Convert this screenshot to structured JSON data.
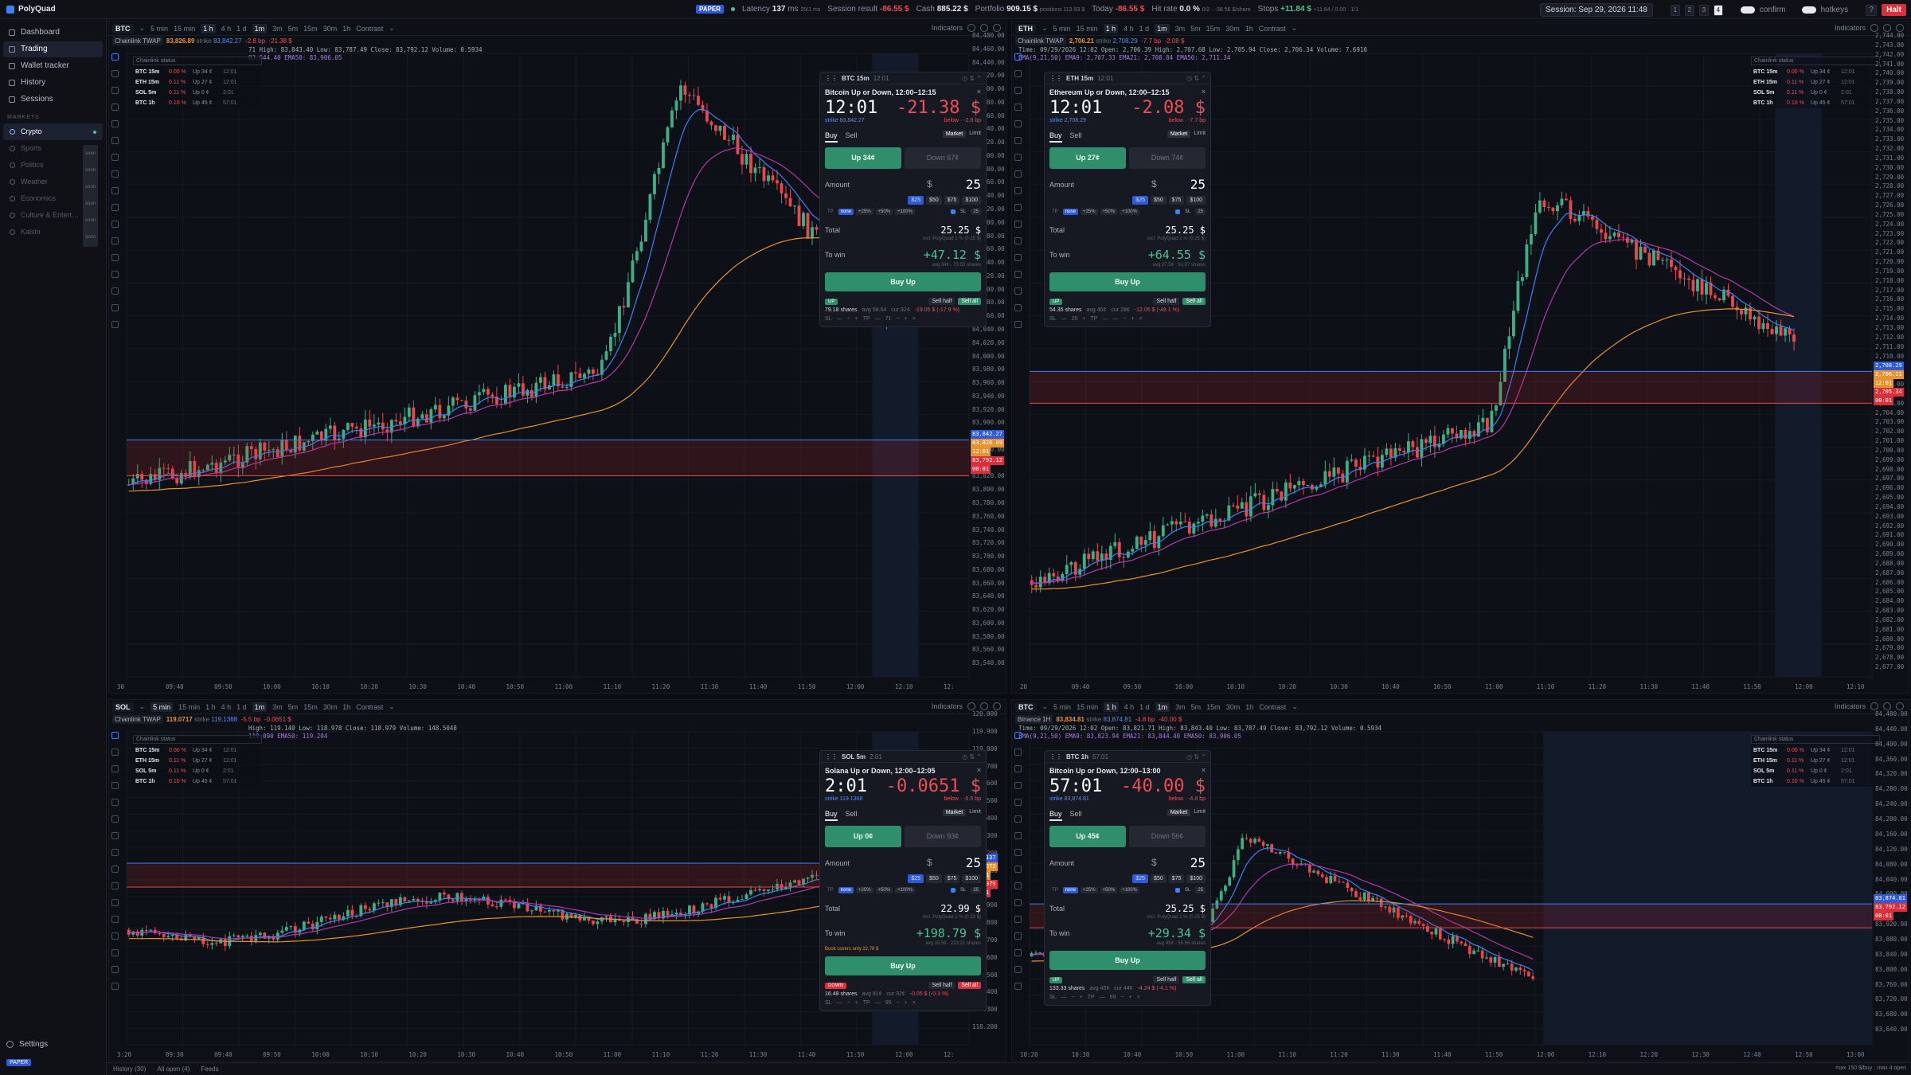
{
  "app": {
    "name": "PolyQuad"
  },
  "topbar": {
    "paper": "PAPER",
    "latency_label": "Latency",
    "latency_value": "137",
    "latency_unit": "ms",
    "latency_extra": "28/1 ms",
    "session_result_label": "Session result",
    "session_result_value": "-86.55 $",
    "cash_label": "Cash",
    "cash_value": "885.22 $",
    "portfolio_label": "Portfolio",
    "portfolio_value": "909.15 $",
    "positions": "positions 113.93 $",
    "today_label": "Today",
    "today_value": "-86.55 $",
    "hit_label": "Hit rate",
    "hit_value": "0.0 %",
    "hit_extra": "0/2 · -38.56 $/share",
    "stops_label": "Stops",
    "stops_value": "+11.84 $",
    "stops_extra": "+11.84 / 0.00 · 1/1",
    "session": "Session: Sep 29, 2026 11:48",
    "layouts": [
      "1",
      "2",
      "3",
      "4"
    ],
    "layout_active": "4",
    "confirm": "confirm",
    "hotkeys": "hotkeys",
    "help": "?",
    "halt": "Halt"
  },
  "sidebar": {
    "nav": [
      {
        "label": "Dashboard"
      },
      {
        "label": "Trading"
      },
      {
        "label": "Wallet tracker"
      },
      {
        "label": "History"
      },
      {
        "label": "Sessions"
      }
    ],
    "nav_active": 1,
    "markets_title": "MARKETS",
    "markets": [
      {
        "label": "Crypto",
        "tag": ""
      },
      {
        "label": "Sports",
        "tag": "soon"
      },
      {
        "label": "Politics",
        "tag": "soon"
      },
      {
        "label": "Weather",
        "tag": "soon"
      },
      {
        "label": "Economics",
        "tag": "soon"
      },
      {
        "label": "Culture & Entert…",
        "tag": "soon"
      },
      {
        "label": "Kalshi",
        "tag": "soon"
      }
    ],
    "settings": "Settings",
    "paper": "PAPER"
  },
  "common": {
    "indicators": "Indicators",
    "contrast": "Contrast",
    "cs_header": "Chainlink status",
    "market": "Market",
    "limit": "Limit",
    "buy": "Buy",
    "sell": "Sell",
    "amount": "Amount",
    "total": "Total",
    "to_win": "To win",
    "sell_half": "Sell half",
    "sell_all": "Sell all",
    "tp": "TP",
    "sl": "SL",
    "none": "none",
    "dollar": "$",
    "tp_opts": [
      "+25%",
      "+50%",
      "+100%"
    ]
  },
  "footer": {
    "history": "History (30)",
    "all_open": "All open (4)",
    "feeds": "Feeds",
    "right": "max 150 $/buy · max 4 open"
  },
  "panels": [
    {
      "symbol": "BTC",
      "tf_active": 2,
      "timeframes": [
        "5 min",
        "15 min",
        "1 h",
        "4 h",
        "1 d",
        "1m",
        "3m",
        "5m",
        "15m",
        "30m",
        "1h"
      ],
      "tf_row_active": 5,
      "source": "Chainlink TWAP",
      "twap": "83,826.89",
      "strike_label": "strike",
      "strike": "83,842.27",
      "diff_bp": "-2.8 bp",
      "diff_usd": "-21.38 $",
      "ohlc": "71   High: 83,843.40   Low: 83,787.49   Close: 83,792.12   Volume: 0.5934",
      "ema": "83,844.40   EMA50: 83,906.05",
      "cs_rows": [
        {
          "n": "BTC 15m",
          "a": "0.00 %",
          "b": "Up 34 ¢",
          "c": "12:01"
        },
        {
          "n": "ETH 15m",
          "a": "0.11 %",
          "b": "Up 27 ¢",
          "c": "12:01"
        },
        {
          "n": "SOL 5m",
          "a": "0.11 %",
          "b": "Up 0 ¢",
          "c": "2:01"
        },
        {
          "n": "BTC 1h",
          "a": "0.10 %",
          "b": "Up 45 ¢",
          "c": "57:01"
        }
      ],
      "yticks": [
        "84,480.00",
        "84,460.00",
        "84,440.00",
        "84,420.00",
        "84,400.00",
        "84,380.00",
        "84,360.00",
        "84,340.00",
        "84,320.00",
        "84,300.00",
        "84,280.00",
        "84,260.00",
        "84,240.00",
        "84,220.00",
        "84,200.00",
        "84,180.00",
        "84,160.00",
        "84,140.00",
        "84,120.00",
        "84,100.00",
        "84,080.00",
        "84,060.00",
        "84,040.00",
        "84,020.00",
        "84,000.00",
        "83,980.00",
        "83,960.00",
        "83,940.00",
        "83,920.00",
        "83,900.00",
        "83,880.00",
        "83,860.00",
        "83,840.00",
        "83,820.00",
        "83,800.00",
        "83,780.00",
        "83,760.00",
        "83,740.00",
        "83,720.00",
        "83,700.00",
        "83,680.00",
        "83,660.00",
        "83,640.00",
        "83,620.00",
        "83,600.00",
        "83,580.00",
        "83,560.00",
        "83,540.00"
      ],
      "xticks": [
        "30",
        "09:40",
        "09:50",
        "10:00",
        "10:10",
        "10:20",
        "10:30",
        "10:40",
        "10:50",
        "11:00",
        "11:10",
        "11:20",
        "11:30",
        "11:40",
        "11:50",
        "12:00",
        "12:10",
        "12:"
      ],
      "tags": [
        {
          "t": "83,842.27",
          "c": "#2f5bd8"
        },
        {
          "t": "83,826.89",
          "c": "#e8932e"
        },
        {
          "t": "12:01",
          "c": "#e8932e"
        },
        {
          "t": "83,792.12",
          "c": "#dc2f3a"
        },
        {
          "t": "00:01",
          "c": "#dc2f3a"
        }
      ],
      "order": {
        "head": "BTC 15m",
        "head_time": "12:01",
        "title": "Bitcoin Up or Down, 12:00–12:15",
        "countdown": "12:01",
        "pnl": "-21.38 $",
        "strike": "strike 83,842.27",
        "below": "below · -2.8 bp",
        "up": "Up 34¢",
        "down": "Down 67¢",
        "amount": "25",
        "chips": [
          "$25",
          "$50",
          "$75",
          "$100"
        ],
        "sl_val": "25",
        "total": "25.25 $",
        "incl": "incl. PolyQuad 1 % (0.25 $)",
        "win": "+47.12 $",
        "avg": "avg 34¢ · 73.53 shares",
        "book": "",
        "buy_label": "Buy Up",
        "pos_side": "UP",
        "pos_line": "79.18 shares",
        "pos_avg": "avg 58.54",
        "pos_cur": "cur 324",
        "pos_pnl": "-19.05 $ (-17.9 %)",
        "ctl": [
          "SL",
          "—",
          "−",
          "+",
          "TP",
          "—",
          "71",
          "−",
          "+",
          "×"
        ]
      }
    },
    {
      "symbol": "ETH",
      "tf_active": 2,
      "timeframes": [
        "5 min",
        "15 min",
        "1 h",
        "4 h",
        "1 d",
        "1m",
        "3m",
        "5m",
        "15m",
        "30m",
        "1h"
      ],
      "tf_row_active": 5,
      "source": "Chainlink TWAP",
      "twap": "2,706.21",
      "strike_label": "strike",
      "strike": "2,708.29",
      "diff_bp": "-7.7 bp",
      "diff_usd": "-2.08 $",
      "ohlc": "Time: 09/29/2026 12:02   Open: 2,706.39   High: 2,707.68   Low: 2,705.94   Close: 2,706.34   Volume: 7.6910",
      "ema": "EMA(9,21,50)   EMA9: 2,707.33   EMA21: 2,708.84   EMA50: 2,711.34",
      "cs_rows": [
        {
          "n": "BTC 15m",
          "a": "0.00 %",
          "b": "Up 34 ¢",
          "c": "12:01"
        },
        {
          "n": "ETH 15m",
          "a": "0.11 %",
          "b": "Up 27 ¢",
          "c": "12:01"
        },
        {
          "n": "SOL 5m",
          "a": "0.11 %",
          "b": "Up 0 ¢",
          "c": "2:01"
        },
        {
          "n": "BTC 1h",
          "a": "0.10 %",
          "b": "Up 45 ¢",
          "c": "57:01"
        }
      ],
      "yticks": [
        "2,744.00",
        "2,743.00",
        "2,742.00",
        "2,741.00",
        "2,740.00",
        "2,739.00",
        "2,738.00",
        "2,737.00",
        "2,736.00",
        "2,735.00",
        "2,734.00",
        "2,733.00",
        "2,732.00",
        "2,731.00",
        "2,730.00",
        "2,729.00",
        "2,728.00",
        "2,727.00",
        "2,726.00",
        "2,725.00",
        "2,724.00",
        "2,723.00",
        "2,722.00",
        "2,721.00",
        "2,720.00",
        "2,719.00",
        "2,718.00",
        "2,717.00",
        "2,716.00",
        "2,715.00",
        "2,714.00",
        "2,713.00",
        "2,712.00",
        "2,711.00",
        "2,710.00",
        "2,709.00",
        "2,708.00",
        "2,707.00",
        "2,706.00",
        "2,705.00",
        "2,704.00",
        "2,703.00",
        "2,702.00",
        "2,701.00",
        "2,700.00",
        "2,699.00",
        "2,698.00",
        "2,697.00",
        "2,696.00",
        "2,695.00",
        "2,694.00",
        "2,693.00",
        "2,692.00",
        "2,691.00",
        "2,690.00",
        "2,689.00",
        "2,688.00",
        "2,687.00",
        "2,686.00",
        "2,685.00",
        "2,684.00",
        "2,683.00",
        "2,682.00",
        "2,681.00",
        "2,680.00",
        "2,679.00",
        "2,678.00",
        "2,677.00"
      ],
      "xticks": [
        "20",
        "09:40",
        "09:50",
        "10:00",
        "10:10",
        "10:20",
        "10:30",
        "10:40",
        "10:50",
        "11:00",
        "11:10",
        "11:20",
        "11:30",
        "11:40",
        "11:50",
        "12:00",
        "12:10"
      ],
      "tags": [
        {
          "t": "2,708.29",
          "c": "#2f5bd8"
        },
        {
          "t": "2,706.21",
          "c": "#e8932e"
        },
        {
          "t": "12:01",
          "c": "#e8932e"
        },
        {
          "t": "2,705.34",
          "c": "#dc2f3a"
        },
        {
          "t": "00:01",
          "c": "#dc2f3a"
        }
      ],
      "order": {
        "head": "ETH 15m",
        "head_time": "12:01",
        "title": "Ethereum Up or Down, 12:00–12:15",
        "countdown": "12:01",
        "pnl": "-2.08 $",
        "strike": "strike 2,708.29",
        "below": "below · -7.7 bp",
        "up": "Up 27¢",
        "down": "Down 74¢",
        "amount": "25",
        "chips": [
          "$25",
          "$50",
          "$75",
          "$100"
        ],
        "sl_val": "25",
        "total": "25.25 $",
        "incl": "incl. PolyQuad 1 % (0.25 $)",
        "win": "+64.55 $",
        "avg": "avg 27.5¢ · 91.07 shares",
        "book": "",
        "buy_label": "Buy Up",
        "pos_side": "UP",
        "pos_line": "54.35 shares",
        "pos_avg": "avg 46¢",
        "pos_cur": "cur 28¢",
        "pos_pnl": "-12.05 $ (-48.1 %)",
        "ctl": [
          "SL",
          "—",
          "25",
          "+",
          "TP",
          "—",
          "—",
          "−",
          "+",
          "×"
        ]
      }
    },
    {
      "symbol": "SOL",
      "tf_active": 0,
      "timeframes": [
        "5 min",
        "15 min",
        "1 h",
        "4 h",
        "1 d",
        "1m",
        "3m",
        "5m",
        "15m",
        "30m",
        "1h"
      ],
      "tf_row_active": 5,
      "source": "Chainlink TWAP",
      "twap": "119.0717",
      "strike_label": "strike",
      "strike": "119.1368",
      "diff_bp": "-5.5 bp",
      "diff_usd": "-0.0651 $",
      "ohlc": "High: 119.140   Low: 118.978   Close: 118.979   Volume: 148.5048",
      "ema": "119.090   EMA50: 119.204",
      "cs_rows": [
        {
          "n": "BTC 15m",
          "a": "0.00 %",
          "b": "Up 34 ¢",
          "c": "12:01"
        },
        {
          "n": "ETH 15m",
          "a": "0.11 %",
          "b": "Up 27 ¢",
          "c": "12:01"
        },
        {
          "n": "SOL 5m",
          "a": "0.11 %",
          "b": "Up 0 ¢",
          "c": "2:01"
        },
        {
          "n": "BTC 1h",
          "a": "0.10 %",
          "b": "Up 45 ¢",
          "c": "57:01"
        }
      ],
      "yticks": [
        "120.000",
        "119.900",
        "119.800",
        "119.700",
        "119.600",
        "119.500",
        "119.400",
        "119.300",
        "119.200",
        "119.100",
        "119.000",
        "118.900",
        "118.800",
        "118.700",
        "118.600",
        "118.500",
        "118.400",
        "118.300",
        "118.200"
      ],
      "xticks": [
        "3:20",
        "09:30",
        "09:40",
        "09:50",
        "10:00",
        "10:10",
        "10:20",
        "10:30",
        "10:40",
        "10:50",
        "11:00",
        "11:10",
        "11:20",
        "11:30",
        "11:40",
        "11:50",
        "12:00",
        "12:"
      ],
      "tags": [
        {
          "t": "119.137",
          "c": "#2f5bd8"
        },
        {
          "t": "119.072",
          "c": "#e8932e"
        },
        {
          "t": "02:01",
          "c": "#e8932e"
        },
        {
          "t": "118.979",
          "c": "#dc2f3a"
        },
        {
          "t": "00:01",
          "c": "#dc2f3a"
        }
      ],
      "order": {
        "head": "SOL 5m",
        "head_time": "2:01",
        "title": "Solana Up or Down, 12:00–12:05",
        "countdown": "2:01",
        "pnl": "-0.0651 $",
        "strike": "strike 119.1368",
        "below": "below · -5.5 bp",
        "up": "Up 0¢",
        "down": "Down 93¢",
        "amount": "25",
        "chips": [
          "$25",
          "$50",
          "$75",
          "$100"
        ],
        "sl_val": "25",
        "total": "22.99 $",
        "incl": "incl. PolyQuad 1 % (0.23 $)",
        "win": "+198.79 $",
        "avg": "avg 10.5¢ · 223.21 shares",
        "book": "Book covers only 22.76 $",
        "buy_label": "Buy Up",
        "pos_side": "DOWN",
        "pos_line": "16.48 shares",
        "pos_avg": "avg 91¢",
        "pos_cur": "cur 92¢",
        "pos_pnl": "-0.05 $ (-0.3 %)",
        "ctl": [
          "SL",
          "—",
          "−",
          "+",
          "TP",
          "—",
          "99",
          "−",
          "+",
          "×"
        ]
      }
    },
    {
      "symbol": "BTC",
      "tf_active": 2,
      "timeframes": [
        "5 min",
        "15 min",
        "1 h",
        "4 h",
        "1 d",
        "1m",
        "3m",
        "5m",
        "15m",
        "30m",
        "1h"
      ],
      "tf_row_active": 5,
      "source": "Binance 1H",
      "twap": "83,834.81",
      "strike_label": "strike",
      "strike": "83,874.81",
      "diff_bp": "-4.8 bp",
      "diff_usd": "-40.00 $",
      "ohlc": "Time: 09/29/2026 12:02   Open: 83,821.71   High: 83,843.40   Low: 83,787.49   Close: 83,792.12   Volume: 0.5934",
      "ema": "EMA(9,21,50)   EMA9: 83,823.94   EMA21: 83,844.40   EMA50: 83,906.05",
      "cs_rows": [
        {
          "n": "BTC 15m",
          "a": "0.00 %",
          "b": "Up 34 ¢",
          "c": "12:01"
        },
        {
          "n": "ETH 15m",
          "a": "0.11 %",
          "b": "Up 27 ¢",
          "c": "12:01"
        },
        {
          "n": "SOL 5m",
          "a": "0.11 %",
          "b": "Up 0 ¢",
          "c": "2:01"
        },
        {
          "n": "BTC 1h",
          "a": "0.10 %",
          "b": "Up 45 ¢",
          "c": "57:01"
        }
      ],
      "yticks": [
        "84,480.00",
        "84,440.00",
        "84,400.00",
        "84,360.00",
        "84,320.00",
        "84,280.00",
        "84,240.00",
        "84,200.00",
        "84,160.00",
        "84,120.00",
        "84,080.00",
        "84,040.00",
        "84,000.00",
        "83,960.00",
        "83,920.00",
        "83,880.00",
        "83,840.00",
        "83,800.00",
        "83,760.00",
        "83,720.00",
        "83,680.00",
        "83,640.00"
      ],
      "xticks": [
        "10:20",
        "10:30",
        "10:40",
        "10:50",
        "11:00",
        "11:10",
        "11:20",
        "11:30",
        "11:40",
        "11:50",
        "12:00",
        "12:10",
        "12:20",
        "12:30",
        "12:40",
        "12:50",
        "13:00"
      ],
      "tags": [
        {
          "t": "83,874.81",
          "c": "#2f5bd8"
        },
        {
          "t": "83,792.12",
          "c": "#dc2f3a"
        },
        {
          "t": "00:01",
          "c": "#dc2f3a"
        }
      ],
      "order": {
        "head": "BTC 1h",
        "head_time": "57:01",
        "title": "Bitcoin Up or Down, 12:00–13:00",
        "countdown": "57:01",
        "pnl": "-40.00 $",
        "strike": "strike 83,874.81",
        "below": "below · -4.8 bp",
        "up": "Up 45¢",
        "down": "Down 56¢",
        "amount": "25",
        "chips": [
          "$25",
          "$50",
          "$75",
          "$100"
        ],
        "sl_val": "25",
        "total": "25.25 $",
        "incl": "incl. PolyQuad 1 % (0.25 $)",
        "win": "+29.34 $",
        "avg": "avg 45¢ · 55.56 shares",
        "book": "",
        "buy_label": "Buy Up",
        "pos_side": "UP",
        "pos_line": "133.33 shares",
        "pos_avg": "avg 45¢",
        "pos_cur": "cur 44¢",
        "pos_pnl": "-4.24 $ (-4.1 %)",
        "ctl": [
          "SL",
          "—",
          "−",
          "+",
          "TP",
          "—",
          "69",
          "−",
          "+",
          "×"
        ]
      }
    }
  ]
}
